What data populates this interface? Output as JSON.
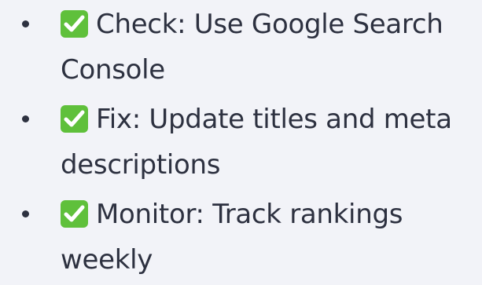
{
  "items": [
    {
      "icon": "check-mark-icon",
      "label": "Check:",
      "text": "Use Google Search Console"
    },
    {
      "icon": "check-mark-icon",
      "label": "Fix:",
      "text": "Update titles and meta descriptions"
    },
    {
      "icon": "check-mark-icon",
      "label": "Monitor:",
      "text": "Track rankings weekly"
    }
  ],
  "colors": {
    "background": "#f2f3f8",
    "text": "#2d3140",
    "check_box": "#5fc03b"
  }
}
